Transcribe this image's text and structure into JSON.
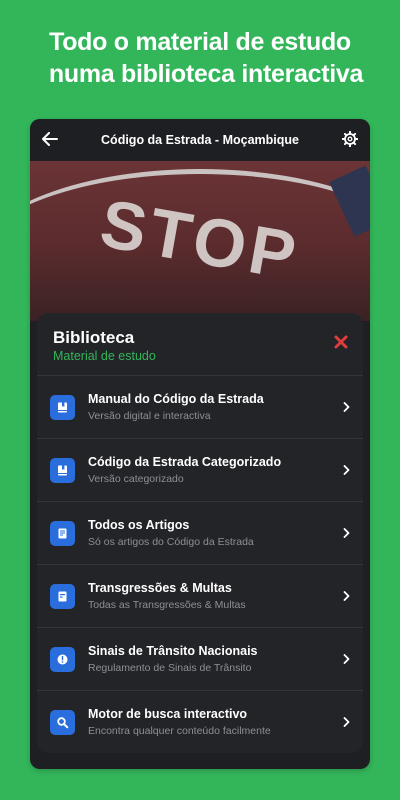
{
  "headline": {
    "line1": "Todo o material de estudo",
    "line2": "numa biblioteca interactiva"
  },
  "appbar": {
    "title": "Código da Estrada - Moçambique",
    "back_icon": "arrow-left-icon",
    "settings_icon": "gear-icon"
  },
  "hero": {
    "sign_text": "STOP"
  },
  "sheet": {
    "title": "Biblioteca",
    "subtitle": "Material de estudo",
    "close_icon": "close-icon",
    "items": [
      {
        "title": "Manual do Código da Estrada",
        "desc": "Versão digital e interactiva",
        "icon": "book-icon"
      },
      {
        "title": "Código da Estrada Categorizado",
        "desc": "Versão categorizado",
        "icon": "book-icon"
      },
      {
        "title": "Todos os Artigos",
        "desc": "Só os artigos do Código da Estrada",
        "icon": "document-icon"
      },
      {
        "title": "Transgressões & Multas",
        "desc": "Todas as Transgressões & Multas",
        "icon": "ticket-icon"
      },
      {
        "title": "Sinais de Trânsito Nacionais",
        "desc": "Regulamento de Sinais de Trânsito",
        "icon": "info-icon"
      },
      {
        "title": "Motor de busca interactivo",
        "desc": "Encontra qualquer conteúdo facilmente",
        "icon": "search-icon"
      }
    ]
  },
  "colors": {
    "background": "#33b65a",
    "accent": "#33b65a",
    "icon_bg": "#2a6ede",
    "close": "#e03c3c"
  }
}
